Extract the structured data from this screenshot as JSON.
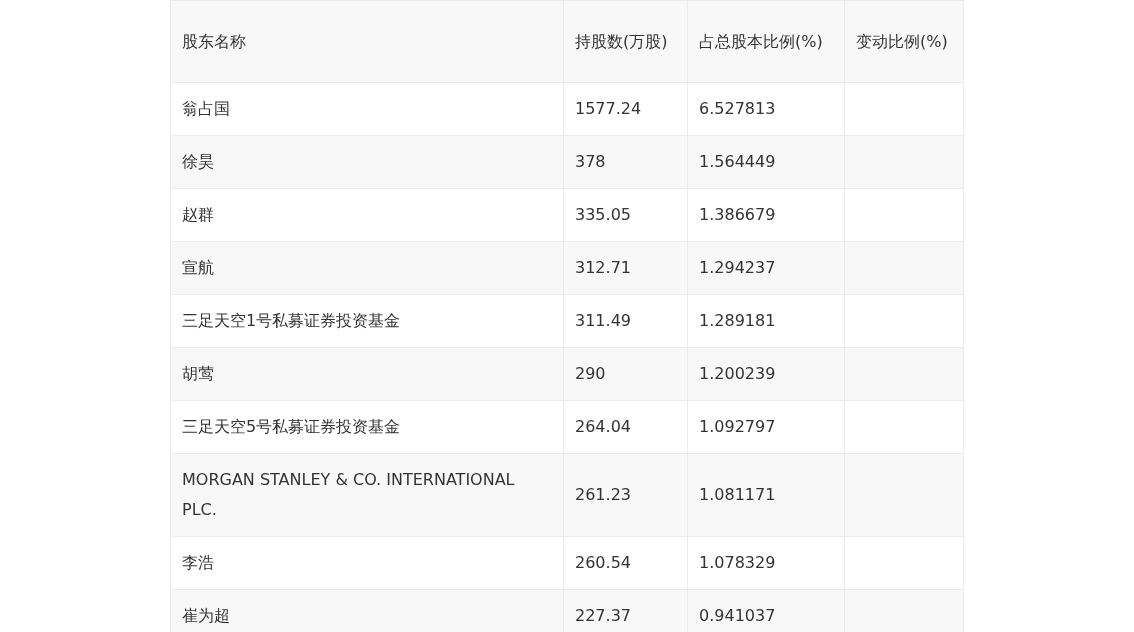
{
  "table": {
    "columns": [
      "股东名称",
      "持股数(万股)",
      "占总股本比例(%)",
      "变动比例(%)"
    ],
    "rows": [
      {
        "name": "翁占国",
        "shares": "1577.24",
        "ratio": "6.527813"
      },
      {
        "name": "徐昊",
        "shares": "378",
        "ratio": "1.564449"
      },
      {
        "name": "赵群",
        "shares": "335.05",
        "ratio": "1.386679"
      },
      {
        "name": "宣航",
        "shares": "312.71",
        "ratio": "1.294237"
      },
      {
        "name": "三足天空1号私募证券投资基金",
        "shares": "311.49",
        "ratio": "1.289181"
      },
      {
        "name": "胡莺",
        "shares": "290",
        "ratio": "1.200239"
      },
      {
        "name": "三足天空5号私募证券投资基金",
        "shares": "264.04",
        "ratio": "1.092797"
      },
      {
        "name": "MORGAN STANLEY & CO. INTERNATIONAL PLC.",
        "shares": "261.23",
        "ratio": "1.081171"
      },
      {
        "name": "李浩",
        "shares": "260.54",
        "ratio": "1.078329"
      },
      {
        "name": "崔为超",
        "shares": "227.37",
        "ratio": "0.941037"
      }
    ]
  }
}
